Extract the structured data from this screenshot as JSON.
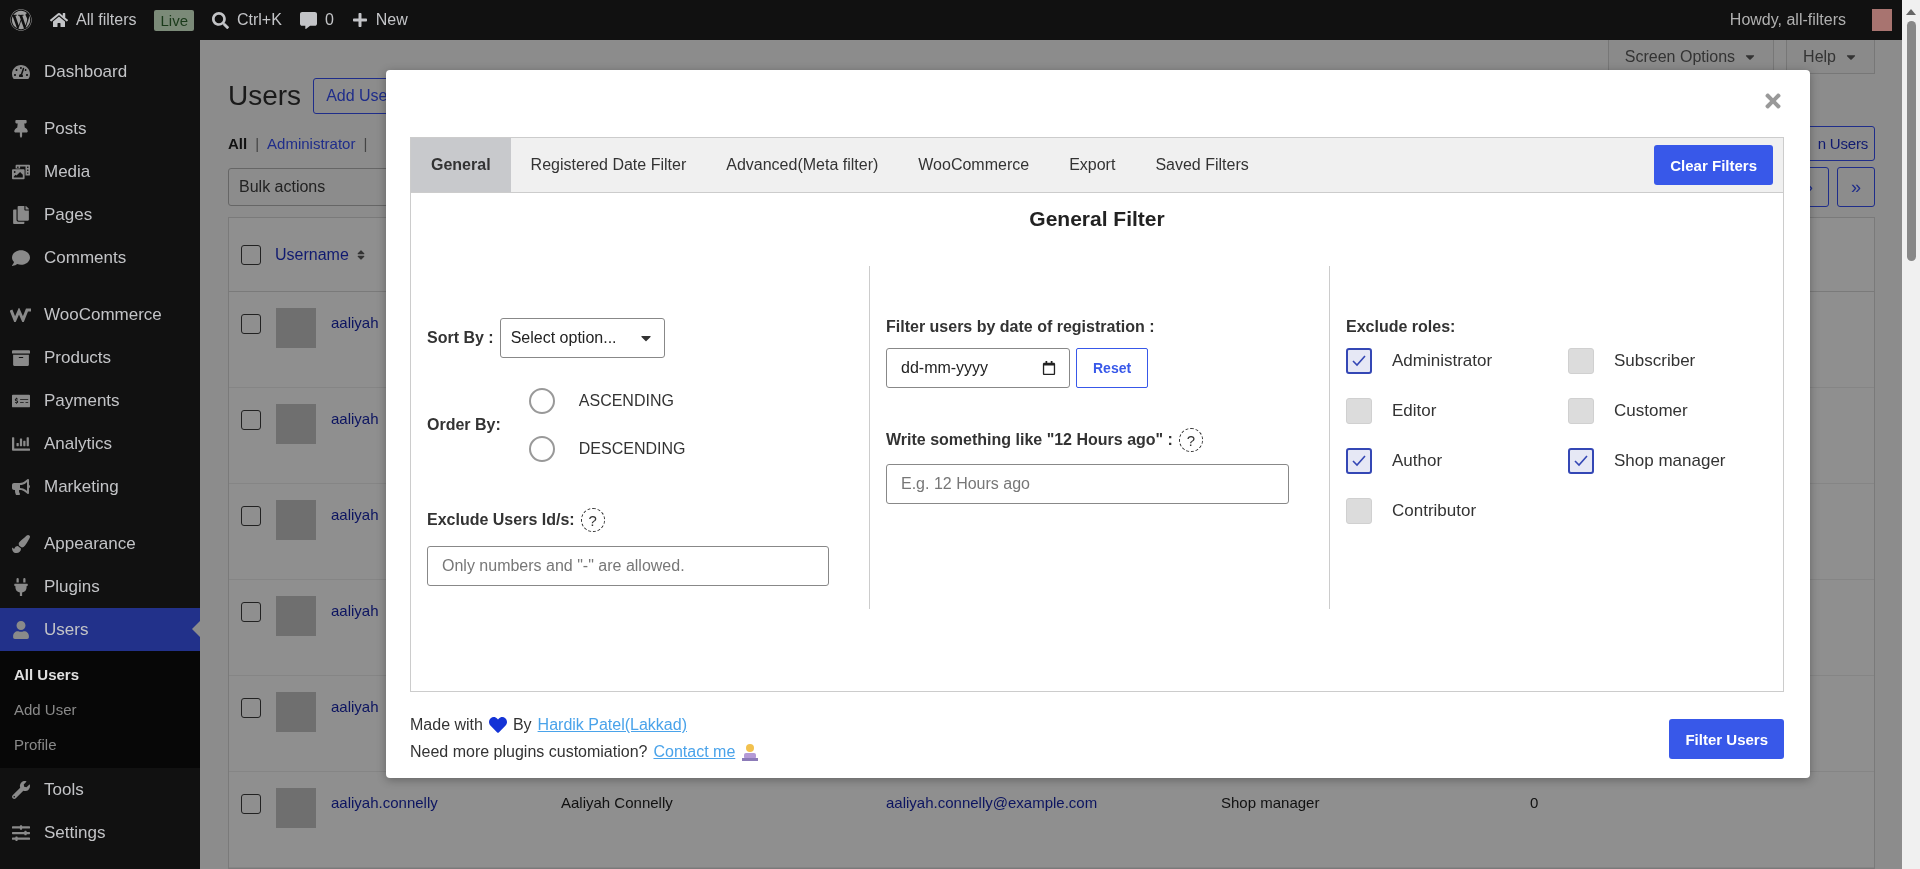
{
  "admin_bar": {
    "site": "All filters",
    "live": "Live",
    "search": "Ctrl+K",
    "comments": "0",
    "new": "New",
    "greeting": "Howdy, all-filters"
  },
  "sidebar": {
    "groups": [
      {
        "items": [
          {
            "label": "Dashboard",
            "kind": "dashboard",
            "selected": false
          }
        ]
      },
      {
        "items": [
          {
            "label": "Posts",
            "kind": "posts",
            "selected": false
          },
          {
            "label": "Media",
            "kind": "media",
            "selected": false
          },
          {
            "label": "Pages",
            "kind": "pages",
            "selected": false
          },
          {
            "label": "Comments",
            "kind": "comments",
            "selected": false
          }
        ]
      },
      {
        "items": [
          {
            "label": "WooCommerce",
            "kind": "woo",
            "selected": false
          },
          {
            "label": "Products",
            "kind": "products",
            "selected": false
          },
          {
            "label": "Payments",
            "kind": "payments",
            "selected": false
          },
          {
            "label": "Analytics",
            "kind": "analytics",
            "selected": false
          },
          {
            "label": "Marketing",
            "kind": "marketing",
            "selected": false
          }
        ]
      },
      {
        "items": [
          {
            "label": "Appearance",
            "kind": "appearance",
            "selected": false
          },
          {
            "label": "Plugins",
            "kind": "plugins",
            "selected": false
          },
          {
            "label": "Users",
            "kind": "users",
            "selected": true,
            "children": [
              {
                "label": "All Users",
                "selected": true
              },
              {
                "label": "Add User",
                "selected": false
              },
              {
                "label": "Profile",
                "selected": false
              }
            ]
          },
          {
            "label": "Tools",
            "kind": "tools",
            "selected": false
          },
          {
            "label": "Settings",
            "kind": "settings",
            "selected": false
          }
        ]
      }
    ]
  },
  "page": {
    "title": "Users",
    "add_button": "Add Use",
    "screen_options": "Screen Options",
    "help": "Help",
    "filters": [
      {
        "label": "All",
        "selected": true,
        "separator": "|"
      },
      {
        "label": "Administrator",
        "selected": false,
        "separator": "|"
      }
    ],
    "search_button": "n Users",
    "bulk_actions": "Bulk actions",
    "pager": [
      "›",
      "»"
    ],
    "table": {
      "select_all_checked": false,
      "columns": [
        {
          "label": "Username"
        }
      ],
      "rows": [
        {
          "checked": false,
          "username": "aaliyah"
        },
        {
          "checked": false,
          "username": "aaliyah"
        },
        {
          "checked": false,
          "username": "aaliyah"
        },
        {
          "checked": false,
          "username": "aaliyah"
        },
        {
          "checked": false,
          "username": "aaliyah"
        },
        {
          "checked": false,
          "username": "aaliyah.connelly",
          "name": "Aaliyah Connelly",
          "email": "aaliyah.connelly@example.com",
          "role": "Shop manager",
          "posts": "0"
        }
      ]
    }
  },
  "modal": {
    "tabs": [
      {
        "label": "General",
        "selected": true
      },
      {
        "label": "Registered Date Filter",
        "selected": false
      },
      {
        "label": "Advanced(Meta filter)",
        "selected": false
      },
      {
        "label": "WooCommerce",
        "selected": false
      },
      {
        "label": "Export",
        "selected": false
      },
      {
        "label": "Saved Filters",
        "selected": false
      }
    ],
    "clear_button": "Clear Filters",
    "heading": "General Filter",
    "sort": {
      "label": "Sort By :",
      "value": "Select option..."
    },
    "order": {
      "label": "Order By:",
      "options": [
        {
          "label": "ASCENDING",
          "selected": false
        },
        {
          "label": "DESCENDING",
          "selected": false
        }
      ]
    },
    "exclude_ids": {
      "label": "Exclude Users Id/s:",
      "help": "?",
      "placeholder": "Only numbers and \"-\" are allowed."
    },
    "date": {
      "label": "Filter users by date of registration :",
      "placeholder": "dd-mm-yyyy",
      "reset": "Reset"
    },
    "relative": {
      "label": "Write something like \"12 Hours ago\" :",
      "help": "?",
      "placeholder": "E.g. 12 Hours ago"
    },
    "roles": {
      "label": "Exclude roles:",
      "items": [
        {
          "label": "Administrator",
          "checked": true
        },
        {
          "label": "Subscriber",
          "checked": false
        },
        {
          "label": "Editor",
          "checked": false
        },
        {
          "label": "Customer",
          "checked": false
        },
        {
          "label": "Author",
          "checked": true
        },
        {
          "label": "Shop manager",
          "checked": true
        },
        {
          "label": "Contributor",
          "checked": false
        }
      ]
    },
    "footer": {
      "made_with": "Made with",
      "by": "By",
      "author_link": "Hardik Patel(Lakkad)",
      "question": "Need more plugins customiation?",
      "contact_link": "Contact me",
      "button": "Filter Users"
    }
  }
}
